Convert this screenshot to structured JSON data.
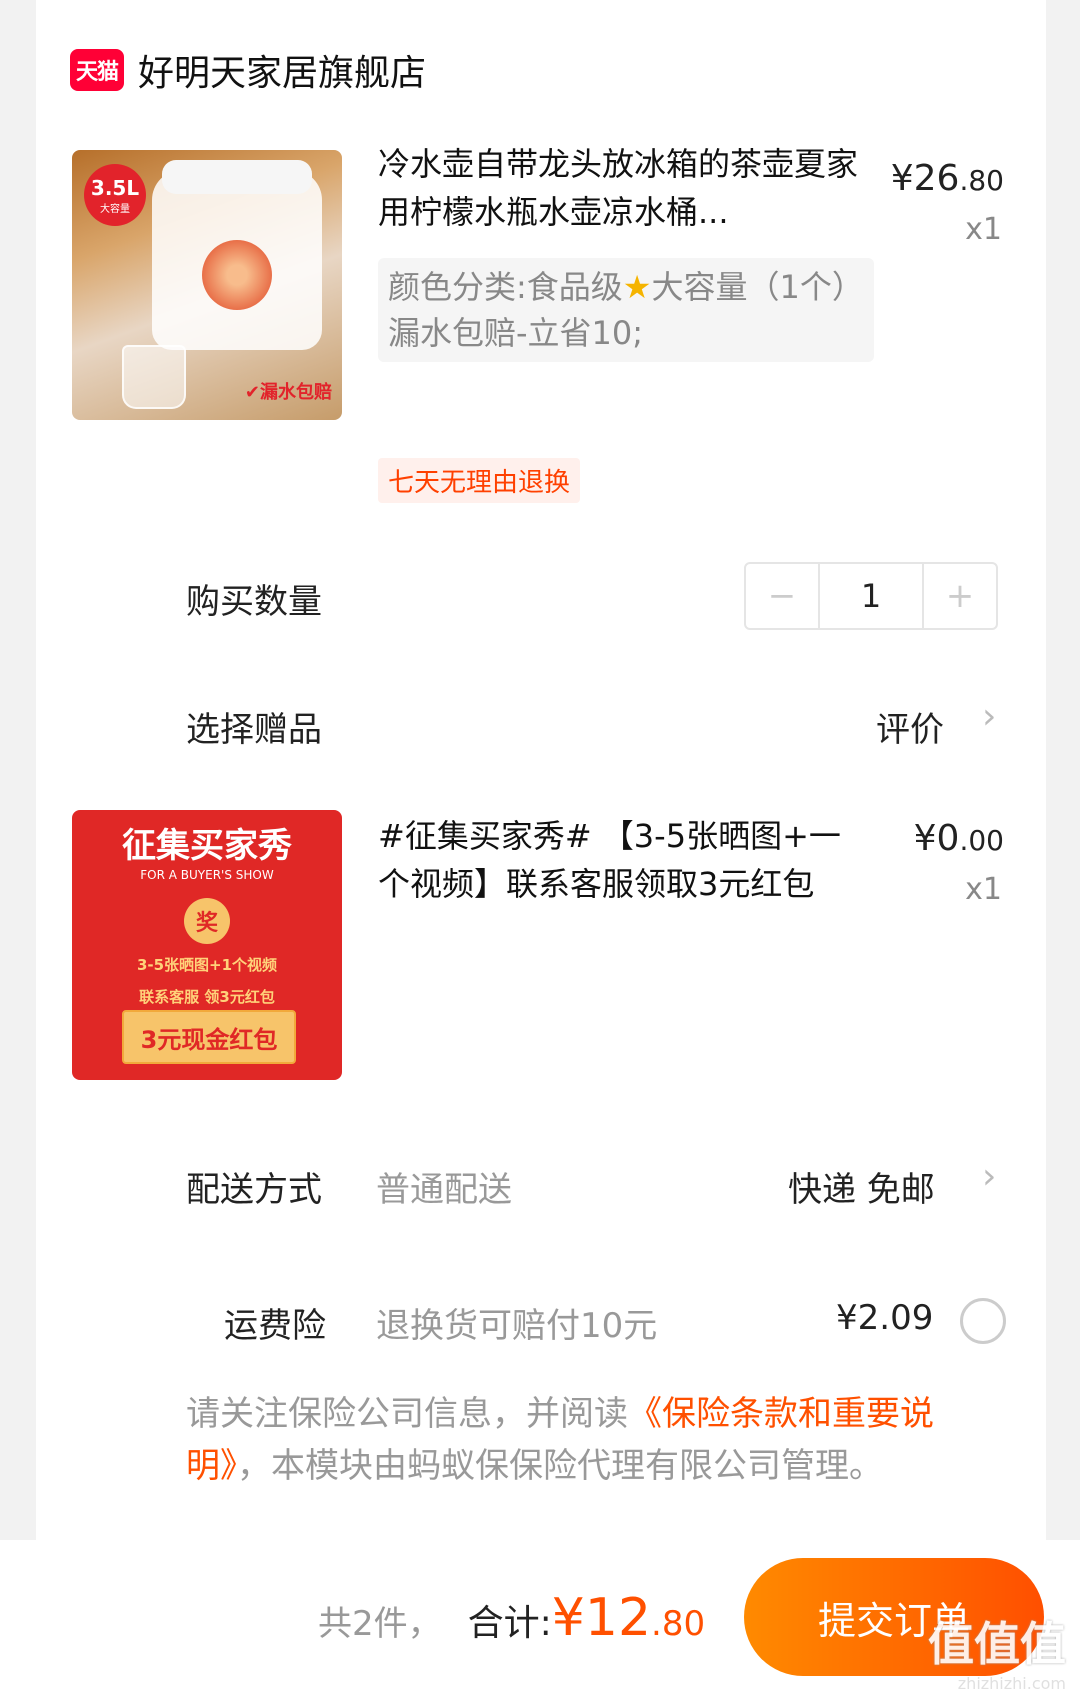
{
  "shop": {
    "badge": "天猫",
    "name": "好明天家居旗舰店"
  },
  "product1": {
    "image_badge": "3.5L",
    "image_badge_sub": "大容量",
    "image_note": "✔漏水包赔",
    "title": "冷水壶自带龙头放冰箱的茶壶夏家用柠檬水瓶水壶凉水桶...",
    "price_main": "¥26",
    "price_dec": ".80",
    "qty": "x1",
    "sku_prefix": "颜色分类:食品级",
    "sku_star": "★",
    "sku_suffix": "大容量（1个）漏水包赔-立省10;",
    "tag": "七天无理由退换"
  },
  "quantity": {
    "label": "购买数量",
    "minus": "−",
    "value": "1",
    "plus": "+"
  },
  "gift": {
    "label": "选择赠品",
    "right": "评价",
    "chevron": "›"
  },
  "product2": {
    "image_title": "征集买家秀",
    "image_sub": "FOR A BUYER'S SHOW",
    "image_medal": "奖",
    "image_line1": "3-5张晒图+1个视频",
    "image_line2": "联系客服 领3元红包",
    "image_button": "3元现金红包",
    "title": "#征集买家秀# 【3-5张晒图+一个视频】联系客服领取3元红包",
    "price_main": "¥0",
    "price_dec": ".00",
    "qty": "x1"
  },
  "delivery": {
    "label": "配送方式",
    "sub": "普通配送",
    "right": "快递 免邮",
    "chevron": "›"
  },
  "insurance": {
    "label": "运费险",
    "sub": "退换货可赔付10元",
    "price": "¥2.09"
  },
  "notice": {
    "part1": "请关注保险公司信息，并阅读",
    "link": "《保险条款和重要说明》",
    "part2": "，本模块由蚂蚁保保险代理有限公司管理。"
  },
  "footer": {
    "count": "共2件，",
    "total_label": "合计:",
    "total_main": "¥12",
    "total_dec": ".80",
    "submit": "提交订单"
  },
  "watermark": {
    "big": "值值值",
    "small": "zhizhizhi.com"
  }
}
